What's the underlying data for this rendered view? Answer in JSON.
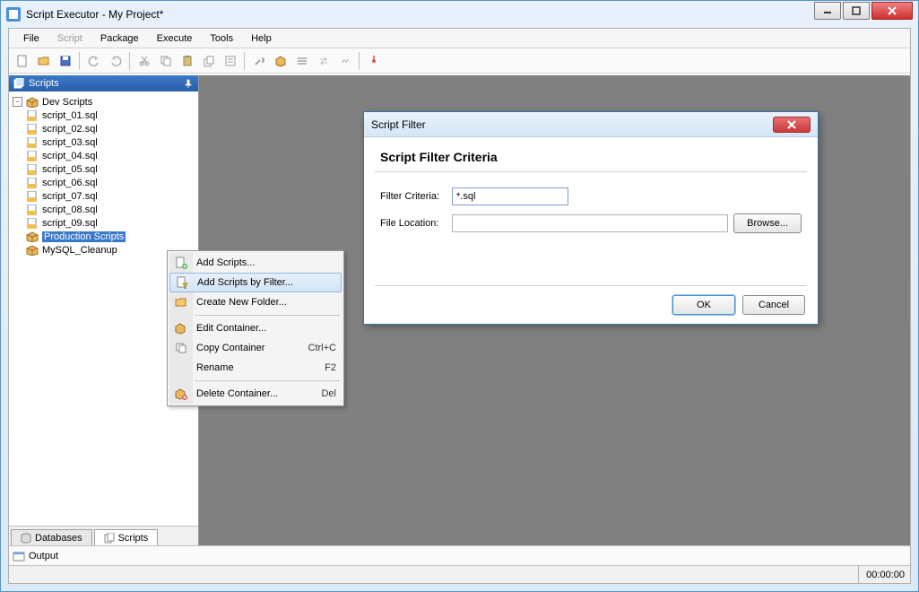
{
  "window": {
    "title": "Script Executor - My Project*"
  },
  "menu": {
    "file": "File",
    "script": "Script",
    "package": "Package",
    "execute": "Execute",
    "tools": "Tools",
    "help": "Help"
  },
  "panel": {
    "title": "Scripts",
    "tab_db": "Databases",
    "tab_scripts": "Scripts"
  },
  "tree": {
    "root": "Dev Scripts",
    "scripts": [
      "script_01.sql",
      "script_02.sql",
      "script_03.sql",
      "script_04.sql",
      "script_05.sql",
      "script_06.sql",
      "script_07.sql",
      "script_08.sql",
      "script_09.sql"
    ],
    "prod": "Production Scripts",
    "mysql": "MySQL_Cleanup"
  },
  "ctx": {
    "add": "Add Scripts...",
    "addfilter": "Add Scripts by Filter...",
    "newfolder": "Create New Folder...",
    "edit": "Edit Container...",
    "copy": "Copy Container",
    "copy_sc": "Ctrl+C",
    "rename": "Rename",
    "rename_sc": "F2",
    "delete": "Delete Container...",
    "delete_sc": "Del"
  },
  "dialog": {
    "title": "Script Filter",
    "heading": "Script Filter Criteria",
    "filter_lbl": "Filter Criteria:",
    "filter_val": "*.sql",
    "loc_lbl": "File Location:",
    "loc_val": "",
    "browse": "Browse...",
    "ok": "OK",
    "cancel": "Cancel"
  },
  "output": {
    "label": "Output"
  },
  "status": {
    "time": "00:00:00"
  }
}
